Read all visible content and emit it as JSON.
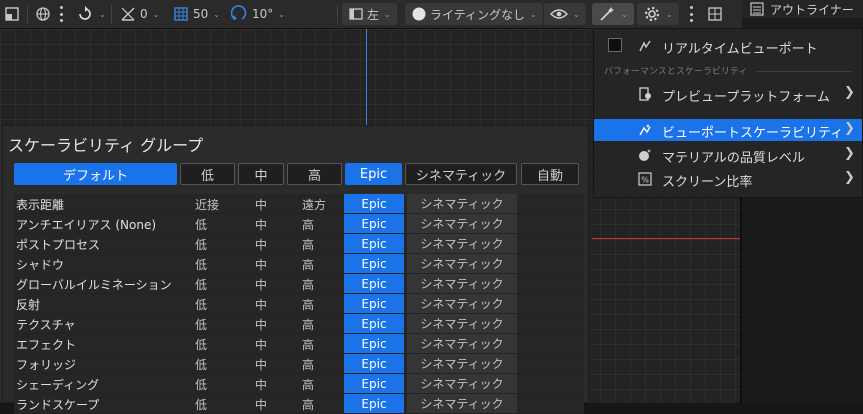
{
  "toolbar": {
    "snap_rotation_value": "0",
    "grid_snap_value": "50",
    "angle_snap_value": "10°",
    "view_layout_label": "左",
    "lighting_label": "ライティングなし",
    "outliner_tab_label": "アウトライナー"
  },
  "panel": {
    "title": "スケーラビリティ グループ",
    "presets": [
      "デフォルト",
      "低",
      "中",
      "高",
      "Epic",
      "シネマティック",
      "自動"
    ],
    "active_preset": "デフォルト",
    "rows": [
      {
        "name": "表示距離",
        "low": "近接",
        "mid": "中",
        "high": "遠方",
        "epic": "Epic",
        "cin": "シネマティック"
      },
      {
        "name": "アンチエイリアス (None)",
        "low": "低",
        "mid": "中",
        "high": "高",
        "epic": "Epic",
        "cin": "シネマティック"
      },
      {
        "name": "ポストプロセス",
        "low": "低",
        "mid": "中",
        "high": "高",
        "epic": "Epic",
        "cin": "シネマティック"
      },
      {
        "name": "シャドウ",
        "low": "低",
        "mid": "中",
        "high": "高",
        "epic": "Epic",
        "cin": "シネマティック"
      },
      {
        "name": "グローバルイルミネーション",
        "low": "低",
        "mid": "中",
        "high": "高",
        "epic": "Epic",
        "cin": "シネマティック"
      },
      {
        "name": "反射",
        "low": "低",
        "mid": "中",
        "high": "高",
        "epic": "Epic",
        "cin": "シネマティック"
      },
      {
        "name": "テクスチャ",
        "low": "低",
        "mid": "中",
        "high": "高",
        "epic": "Epic",
        "cin": "シネマティック"
      },
      {
        "name": "エフェクト",
        "low": "低",
        "mid": "中",
        "high": "高",
        "epic": "Epic",
        "cin": "シネマティック"
      },
      {
        "name": "フォリッジ",
        "low": "低",
        "mid": "中",
        "high": "高",
        "epic": "Epic",
        "cin": "シネマティック"
      },
      {
        "name": "シェーディング",
        "low": "低",
        "mid": "中",
        "high": "高",
        "epic": "Epic",
        "cin": "シネマティック"
      },
      {
        "name": "ランドスケープ",
        "low": "低",
        "mid": "中",
        "high": "高",
        "epic": "Epic",
        "cin": "シネマティック"
      }
    ]
  },
  "menu": {
    "realtime_label": "リアルタイムビューポート",
    "section_label": "パフォーマンスとスケーラビリティ",
    "preview_platform_label": "プレビュープラットフォーム",
    "viewport_scalability_label": "ビューポートスケーラビリティ",
    "material_quality_label": "マテリアルの品質レベル",
    "screen_percentage_label": "スクリーン比率",
    "submenu_arrow": "❯"
  },
  "colors": {
    "accent": "#1a73e8",
    "toolbar_bg": "#2a2a2a",
    "panel_bg": "#2b2b2b",
    "axis_red": "#c0392b",
    "axis_blue": "#3b82e0"
  }
}
